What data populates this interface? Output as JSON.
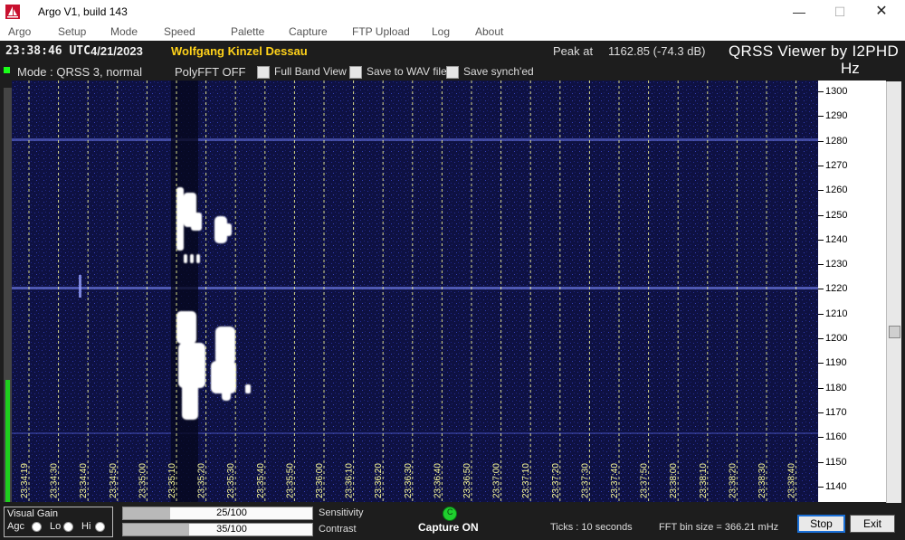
{
  "window": {
    "title": "Argo V1, build 143",
    "minimize_glyph": "—",
    "maximize_glyph": "☐",
    "close_glyph": "✕"
  },
  "menu": [
    "Argo",
    "Setup",
    "Mode",
    "Speed",
    "Palette",
    "Capture",
    "FTP Upload",
    "Log",
    "About"
  ],
  "header": {
    "time": "23:38:46 UTC",
    "date": "4/21/2023",
    "station": "Wolfgang Kinzel Dessau",
    "peak_label": "Peak at",
    "peak_value": "1162.85 (-74.3 dB)",
    "brand": "QRSS Viewer by I2PHD",
    "unit": "Hz"
  },
  "mode_row": {
    "mode": "Mode : QRSS 3, normal",
    "polyfft": "PolyFFT OFF",
    "options": [
      {
        "label": "Full Band View",
        "checked": false
      },
      {
        "label": "Save to WAV file",
        "checked": false
      },
      {
        "label": "Save synch'ed",
        "checked": false
      }
    ]
  },
  "waterfall": {
    "time_labels": [
      "23:34:19",
      "23:34:30",
      "23:34:40",
      "23:34:50",
      "23:35:00",
      "23:35:10",
      "23:35:20",
      "23:35:30",
      "23:35:40",
      "23:35:50",
      "23:36:00",
      "23:36:10",
      "23:36:20",
      "23:36:30",
      "23:36:40",
      "23:36:50",
      "23:37:00",
      "23:37:10",
      "23:37:20",
      "23:37:30",
      "23:37:40",
      "23:37:50",
      "23:38:00",
      "23:38:10",
      "23:38:20",
      "23:38:30",
      "23:38:40"
    ],
    "freq_labels": [
      "1300",
      "1290",
      "1280",
      "1270",
      "1260",
      "1250",
      "1240",
      "1230",
      "1220",
      "1210",
      "1200",
      "1190",
      "1180",
      "1170",
      "1160",
      "1150",
      "1140"
    ],
    "signal_color": "#ffffff",
    "grid_color": "#ffff99",
    "background_color": "#0d0f3a"
  },
  "controls": {
    "visual_gain_title": "Visual Gain",
    "gain_options": [
      "Agc",
      "Lo",
      "Hi"
    ],
    "sensitivity_value": "25/100",
    "sensitivity_fraction": 0.25,
    "sensitivity_label": "Sensitivity",
    "contrast_value": "35/100",
    "contrast_fraction": 0.35,
    "contrast_label": "Contrast",
    "capture_led_letter": "C",
    "capture_status": "Capture ON",
    "ticks": "Ticks  : 10 seconds",
    "fft_bin": "FFT bin size = 366.21 mHz",
    "stop_label": "Stop",
    "exit_label": "Exit"
  }
}
